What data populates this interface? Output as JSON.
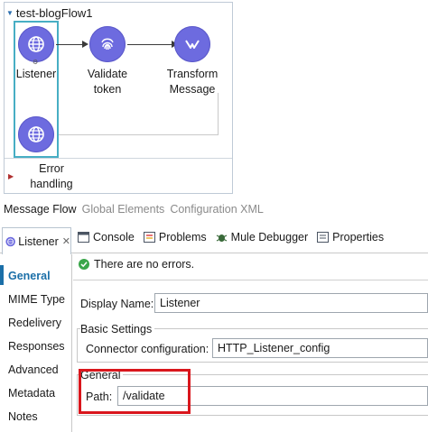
{
  "flow": {
    "name": "test-blogFlow1",
    "nodes": [
      {
        "label": "Listener",
        "icon": "globe-icon"
      },
      {
        "label": "Validate token",
        "icon": "fingerprint-icon"
      },
      {
        "label": "Transform Message",
        "icon": "transform-icon"
      },
      {
        "label": "",
        "icon": "globe-icon"
      }
    ],
    "error_handling_label": "Error handling"
  },
  "editor_tabs": [
    "Message Flow",
    "Global Elements",
    "Configuration XML"
  ],
  "properties": {
    "component_tab": "Listener",
    "view_tabs": [
      {
        "label": "Console",
        "icon": "console-icon"
      },
      {
        "label": "Problems",
        "icon": "problems-icon"
      },
      {
        "label": "Mule Debugger",
        "icon": "debugger-icon"
      },
      {
        "label": "Properties",
        "icon": "properties-icon"
      }
    ],
    "nav_items": [
      "General",
      "MIME Type",
      "Redelivery",
      "Responses",
      "Advanced",
      "Metadata",
      "Notes"
    ],
    "selected_nav": "General",
    "status": "There are no errors.",
    "display_name_label": "Display Name:",
    "display_name_value": "Listener",
    "basic_settings_title": "Basic Settings",
    "connector_label": "Connector configuration:",
    "connector_value": "HTTP_Listener_config",
    "general_title": "General",
    "path_label": "Path:",
    "path_value": "/validate"
  },
  "colors": {
    "node_purple": "#6d6bdf",
    "selection_teal": "#47aec4",
    "highlight_red": "#d9161c",
    "nav_selected_blue": "#1b6fa8",
    "ok_green": "#3aa64a"
  }
}
